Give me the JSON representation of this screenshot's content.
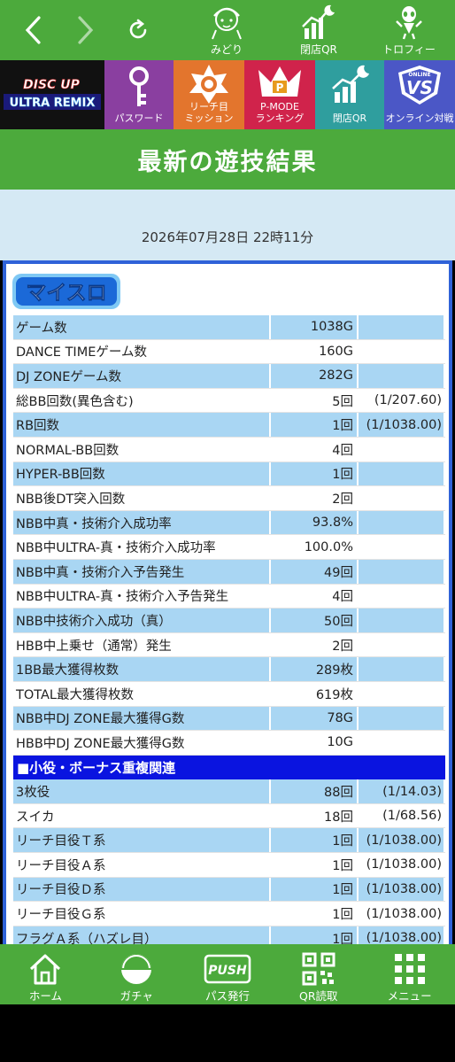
{
  "topbar": {
    "nav": [
      {
        "label": "みどり",
        "icon": "character-face-icon"
      },
      {
        "label": "閉店QR",
        "icon": "chart-moon-icon"
      },
      {
        "label": "トロフィー",
        "icon": "trophy-figure-icon"
      }
    ]
  },
  "menu": {
    "logo_line1": "DISC UP",
    "logo_line2": "ULTRA REMIX",
    "tiles": [
      {
        "label": "パスワード",
        "icon": "key-icon"
      },
      {
        "label1": "リーチ目",
        "label2": "ミッション",
        "icon": "badge-icon"
      },
      {
        "label1": "P-MODE",
        "label2": "ランキング",
        "icon": "crown-icon"
      },
      {
        "label": "閉店QR",
        "icon": "chart-moon-icon"
      },
      {
        "label": "オンライン対戦",
        "icon": "vs-shield-icon",
        "badge": "VS",
        "badge_sub": "ONLINE"
      }
    ],
    "colors": {
      "password": "#8a3fa0",
      "mission": "#e3752d",
      "pmode": "#d0234b",
      "qr": "#2f9e9e",
      "vs": "#4b57c6"
    }
  },
  "page_title": "最新の遊技結果",
  "date": "2026年07月28日 22時11分",
  "brand": "マイスロ",
  "rows": [
    {
      "label": "ゲーム数",
      "value": "1038G",
      "ratio": ""
    },
    {
      "label": "DANCE TIMEゲーム数",
      "value": "160G",
      "ratio": ""
    },
    {
      "label": "DJ ZONEゲーム数",
      "value": "282G",
      "ratio": ""
    },
    {
      "label": "総BB回数(異色含む)",
      "value": "5回",
      "ratio": "(1/207.60)"
    },
    {
      "label": "RB回数",
      "value": "1回",
      "ratio": "(1/1038.00)"
    },
    {
      "label": "NORMAL-BB回数",
      "value": "4回",
      "ratio": ""
    },
    {
      "label": "HYPER-BB回数",
      "value": "1回",
      "ratio": ""
    },
    {
      "label": "NBB後DT突入回数",
      "value": "2回",
      "ratio": ""
    },
    {
      "label": "NBB中真・技術介入成功率",
      "value": "93.8%",
      "ratio": ""
    },
    {
      "label": "NBB中ULTRA-真・技術介入成功率",
      "value": "100.0%",
      "ratio": ""
    },
    {
      "label": "NBB中真・技術介入予告発生",
      "value": "49回",
      "ratio": ""
    },
    {
      "label": "NBB中ULTRA-真・技術介入予告発生",
      "value": "4回",
      "ratio": ""
    },
    {
      "label": "NBB中技術介入成功（真）",
      "value": "50回",
      "ratio": ""
    },
    {
      "label": "HBB中上乗せ（通常）発生",
      "value": "2回",
      "ratio": ""
    },
    {
      "label": "1BB最大獲得枚数",
      "value": "289枚",
      "ratio": ""
    },
    {
      "label": "TOTAL最大獲得枚数",
      "value": "619枚",
      "ratio": ""
    },
    {
      "label": "NBB中DJ ZONE最大獲得G数",
      "value": "78G",
      "ratio": ""
    },
    {
      "label": "HBB中DJ ZONE最大獲得G数",
      "value": "10G",
      "ratio": ""
    }
  ],
  "section_heading": "■小役・ボーナス重複関連",
  "rows2": [
    {
      "label": "3枚役",
      "value": "88回",
      "ratio": "(1/14.03)"
    },
    {
      "label": "スイカ",
      "value": "18回",
      "ratio": "(1/68.56)"
    },
    {
      "label": "リーチ目役Ｔ系",
      "value": "1回",
      "ratio": "(1/1038.00)"
    },
    {
      "label": "リーチ目役Ａ系",
      "value": "1回",
      "ratio": "(1/1038.00)"
    },
    {
      "label": "リーチ目役Ｄ系",
      "value": "1回",
      "ratio": "(1/1038.00)"
    },
    {
      "label": "リーチ目役Ｇ系",
      "value": "1回",
      "ratio": "(1/1038.00)"
    },
    {
      "label": "フラグＡ系（ハズレ目）",
      "value": "1回",
      "ratio": "(1/1038.00)"
    }
  ],
  "tabbar": [
    {
      "label": "ホーム",
      "icon": "home-icon"
    },
    {
      "label": "ガチャ",
      "icon": "gacha-icon"
    },
    {
      "label": "パス発行",
      "icon": "push-pass-icon",
      "badge": "PUSH"
    },
    {
      "label": "QR読取",
      "icon": "qr-code-icon"
    },
    {
      "label": "メニュー",
      "icon": "grid-menu-icon"
    }
  ],
  "colors": {
    "green": "#4caa3c",
    "row_blue": "#a9d6f3",
    "panel_border": "#2f62d8",
    "section_blue": "#0a14e0"
  }
}
